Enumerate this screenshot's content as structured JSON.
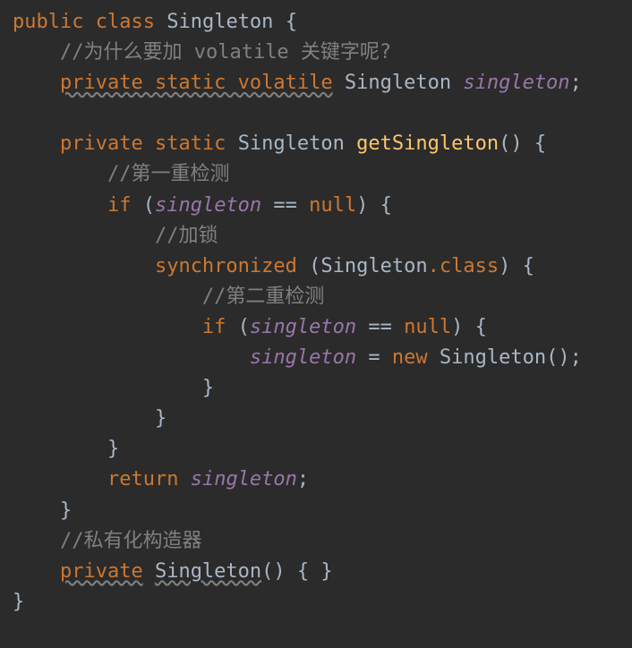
{
  "line1": {
    "kw1": "public",
    "kw2": "class",
    "cls": "Singleton",
    "brace": "{"
  },
  "line2": {
    "cmt": "//为什么要加 volatile 关键字呢?"
  },
  "line3": {
    "mods": "private static volatile",
    "type": "Singleton",
    "var": "singleton",
    "semi": ";"
  },
  "line5": {
    "kw1": "private",
    "kw2": "static",
    "type": "Singleton",
    "mth": "getSingleton",
    "parens": "()",
    "brace": "{"
  },
  "line6": {
    "cmt": "//第一重检测"
  },
  "line7": {
    "kw": "if",
    "open": "(",
    "var": "singleton",
    "eq": " == ",
    "null": "null",
    "close": ")",
    "brace": "{"
  },
  "line8": {
    "cmt": "//加锁"
  },
  "line9": {
    "kw": "synchronized",
    "open": "(",
    "cls": "Singleton",
    "dotclass": ".class",
    "close": ")",
    "brace": "{"
  },
  "line10": {
    "cmt": "//第二重检测"
  },
  "line11": {
    "kw": "if",
    "open": "(",
    "var": "singleton",
    "eq": " == ",
    "null": "null",
    "close": ")",
    "brace": "{"
  },
  "line12": {
    "var": "singleton",
    "assign": " = ",
    "kw": "new",
    "cls": "Singleton",
    "parens": "()",
    "semi": ";"
  },
  "line13": {
    "brace": "}"
  },
  "line14": {
    "brace": "}"
  },
  "line15": {
    "brace": "}"
  },
  "line16": {
    "kw": "return",
    "var": "singleton",
    "semi": ";"
  },
  "line17": {
    "brace": "}"
  },
  "line18": {
    "cmt": "//私有化构造器"
  },
  "line19": {
    "kw": "private",
    "ctor": "Singleton",
    "parens": "()",
    "body": "{ }"
  },
  "line20": {
    "brace": "}"
  }
}
